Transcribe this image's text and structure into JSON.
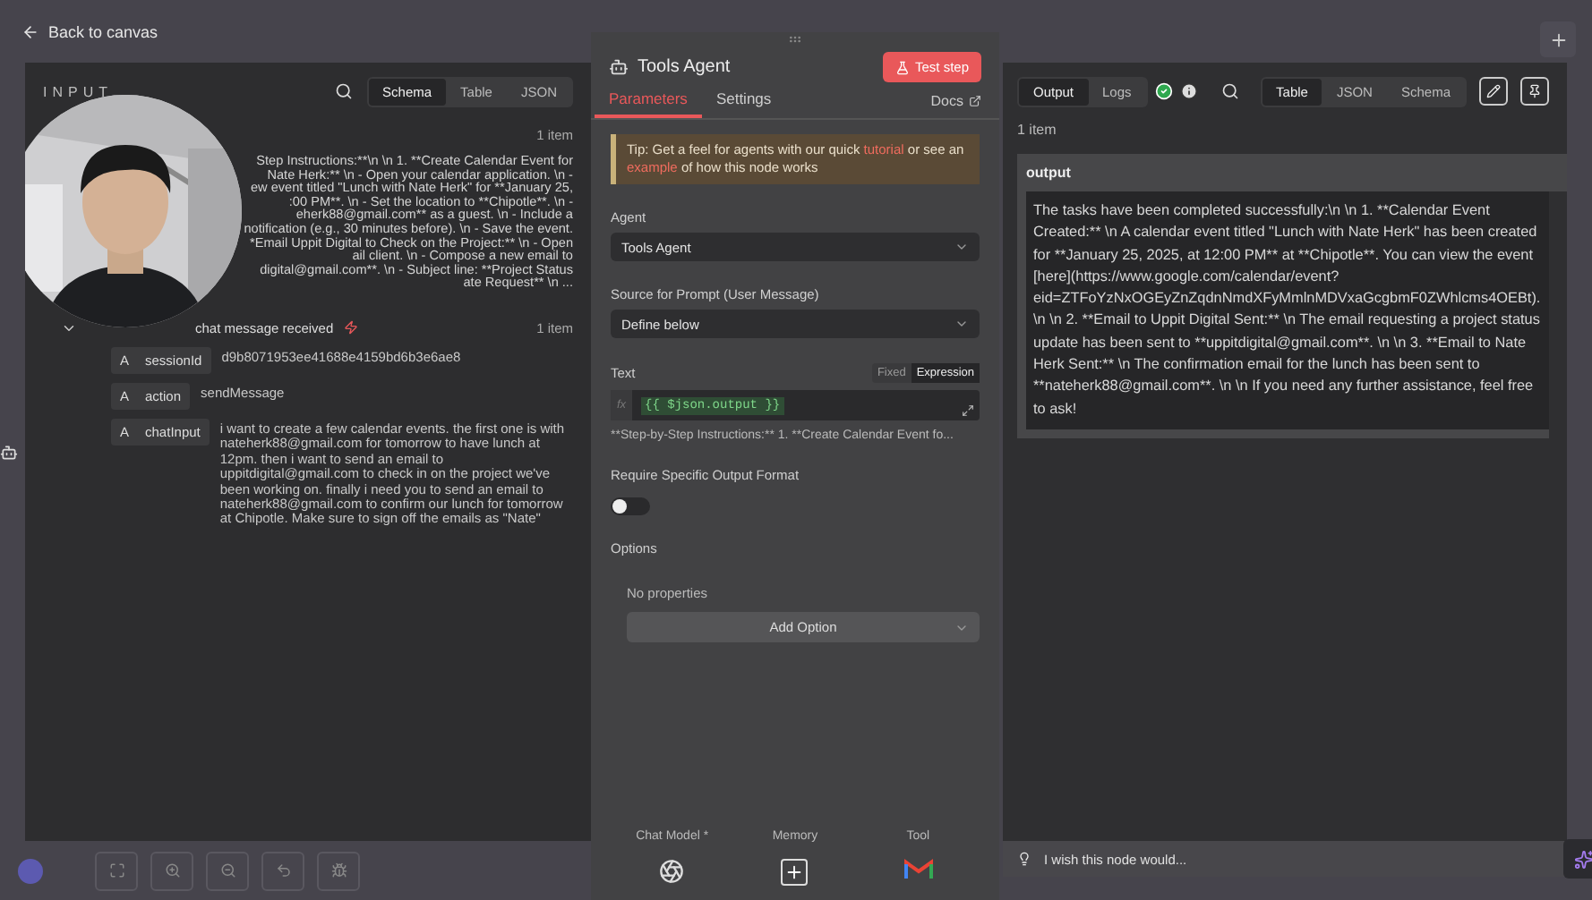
{
  "back_link": "Back to canvas",
  "input_panel": {
    "title": "INPUT",
    "view_tabs": [
      {
        "label": "Schema",
        "selected": true
      },
      {
        "label": "Table",
        "selected": false
      },
      {
        "label": "JSON",
        "selected": false
      }
    ],
    "prompt_preview": {
      "item_count": "1 item",
      "lines": [
        "Step Instructions:**\\n \\n 1. **Create Calendar Event for",
        "Nate Herk:** \\n - Open your calendar application. \\n -",
        "ew event titled \"Lunch with Nate Herk\" for **January 25,",
        ":00 PM**. \\n - Set the location to **Chipotle**. \\n -",
        "eherk88@gmail.com** as a guest. \\n - Include a",
        "notification (e.g., 30 minutes before). \\n - Save the event.",
        "*Email Uppit Digital to Check on the Project:** \\n - Open",
        "ail client. \\n - Compose a new email to",
        "digital@gmail.com**. \\n - Subject line: **Project Status",
        "ate Request** \\n ..."
      ]
    },
    "trigger": {
      "name": "chat message received",
      "item_count": "1 item",
      "expanded": true,
      "fields": [
        {
          "type": "A",
          "key": "sessionId",
          "value": "d9b8071953ee41688e4159bd6b3e6ae8"
        },
        {
          "type": "A",
          "key": "action",
          "value": "sendMessage"
        },
        {
          "type": "A",
          "key": "chatInput",
          "value": "i want to create a few calendar events. the first one is with nateherk88@gmail.com for tomorrow to have lunch at 12pm. then i want to send an email to uppitdigital@gmail.com to check in on the project we've been working on. finally i need you to send an email to nateherk88@gmail.com to confirm our lunch for tomorrow at Chipotle. Make sure to sign off the emails as \"Nate\""
        }
      ]
    }
  },
  "node_panel": {
    "title": "Tools Agent",
    "test_button": "Test step",
    "tabs": [
      {
        "label": "Parameters",
        "selected": true
      },
      {
        "label": "Settings",
        "selected": false
      }
    ],
    "docs_link": "Docs",
    "tip": {
      "before": "Tip: Get a feel for agents with our quick",
      "link_1": "tutorial",
      "middle": "or see an",
      "link_2": "example",
      "after": "of how this node works"
    },
    "agent": {
      "label": "Agent",
      "value": "Tools Agent"
    },
    "prompt_source": {
      "label": "Source for Prompt (User Message)",
      "value": "Define below"
    },
    "text": {
      "label": "Text",
      "modes": [
        {
          "label": "Fixed",
          "selected": false
        },
        {
          "label": "Expression",
          "selected": true
        }
      ],
      "prefix": "fx",
      "expression": "{{ $json.output }}",
      "hint": "**Step-by-Step Instructions:** 1. **Create Calendar Event fo..."
    },
    "output_format": {
      "label": "Require Specific Output Format",
      "on": false
    },
    "options": {
      "label": "Options",
      "empty_text": "No properties",
      "add_button": "Add Option"
    },
    "sub_nodes": [
      {
        "label": "Chat Model *",
        "kind": "model"
      },
      {
        "label": "Memory",
        "kind": "add"
      },
      {
        "label": "Tool",
        "kind": "mail"
      }
    ]
  },
  "output_panel": {
    "tabs": [
      {
        "label": "Output",
        "selected": true
      },
      {
        "label": "Logs",
        "selected": false
      }
    ],
    "view_tabs": [
      {
        "label": "Table",
        "selected": true
      },
      {
        "label": "JSON",
        "selected": false
      },
      {
        "label": "Schema",
        "selected": false
      }
    ],
    "item_count": "1 item",
    "column": "output",
    "cell": "The tasks have been completed successfully:\\n \\n 1. **Calendar Event Created:**  \\n   A calendar event titled \"Lunch with Nate Herk\" has been created for **January 25, 2025, at 12:00 PM** at **Chipotle**. You can view the event [here](https://www.google.com/calendar/event?eid=ZTFoYzNxOGEyZnZqdnNmdXFyMmlnMDVxaGcgbmF0ZWhlcms4OEBt). \\n \\n 2. **Email to Uppit Digital Sent:**  \\n   The email requesting a project status update has been sent to **uppitdigital@gmail.com**. \\n \\n 3. **Email to Nate Herk Sent:**  \\n   The confirmation email for the lunch has been sent to **nateherk88@gmail.com**. \\n \\n If you need any further assistance, feel free to ask!",
    "feedback_placeholder": "I wish this node would..."
  }
}
